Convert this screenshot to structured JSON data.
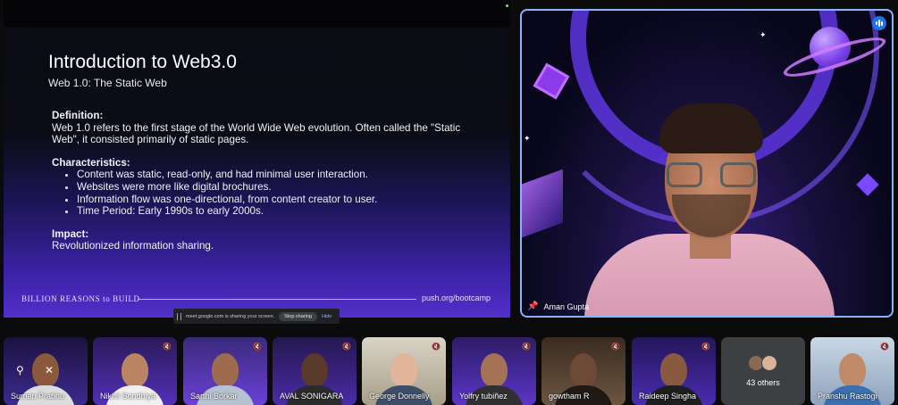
{
  "slide": {
    "title": "Introduction to Web3.0",
    "subtitle": "Web 1.0: The Static Web",
    "definition_heading": "Definition",
    "definition_text": "Web 1.0 refers to the first stage of the World Wide Web evolution. Often called the \"Static Web\", it consisted primarily of static pages.",
    "characteristics_heading": "Characteristics",
    "characteristics": [
      "Content was static, read-only, and had minimal user interaction.",
      "Websites were more like digital brochures.",
      "Information flow was one-directional, from content creator to user.",
      "Time Period: Early 1990s to early 2000s."
    ],
    "impact_heading": "Impact",
    "impact_text": "Revolutionized information sharing.",
    "footer_brand": "BILLION REASONS to BUILD",
    "footer_url": "push.org/bootcamp"
  },
  "share_bar": {
    "message": "meet.google.com is sharing your screen.",
    "stop_label": "Stop sharing",
    "hide_label": "Hide"
  },
  "speaker": {
    "name": "Aman Gupta"
  },
  "participants": [
    {
      "name": "Suman Prabhu"
    },
    {
      "name": "Nikhil Sondhiya"
    },
    {
      "name": "Sarthi Borkar"
    },
    {
      "name": "AVAL SONIGARA"
    },
    {
      "name": "George Donnelly"
    },
    {
      "name": "Yolfry tubiñez"
    },
    {
      "name": "gowtham R"
    },
    {
      "name": "Raideep Singha"
    },
    {
      "name": "Pranshu Rastogi"
    }
  ],
  "others": {
    "label": "43 others"
  },
  "colors": {
    "active_speaker_border": "#8ab4f8",
    "audio_indicator": "#1a73e8",
    "slide_gradient_bottom": "#5230c9"
  }
}
